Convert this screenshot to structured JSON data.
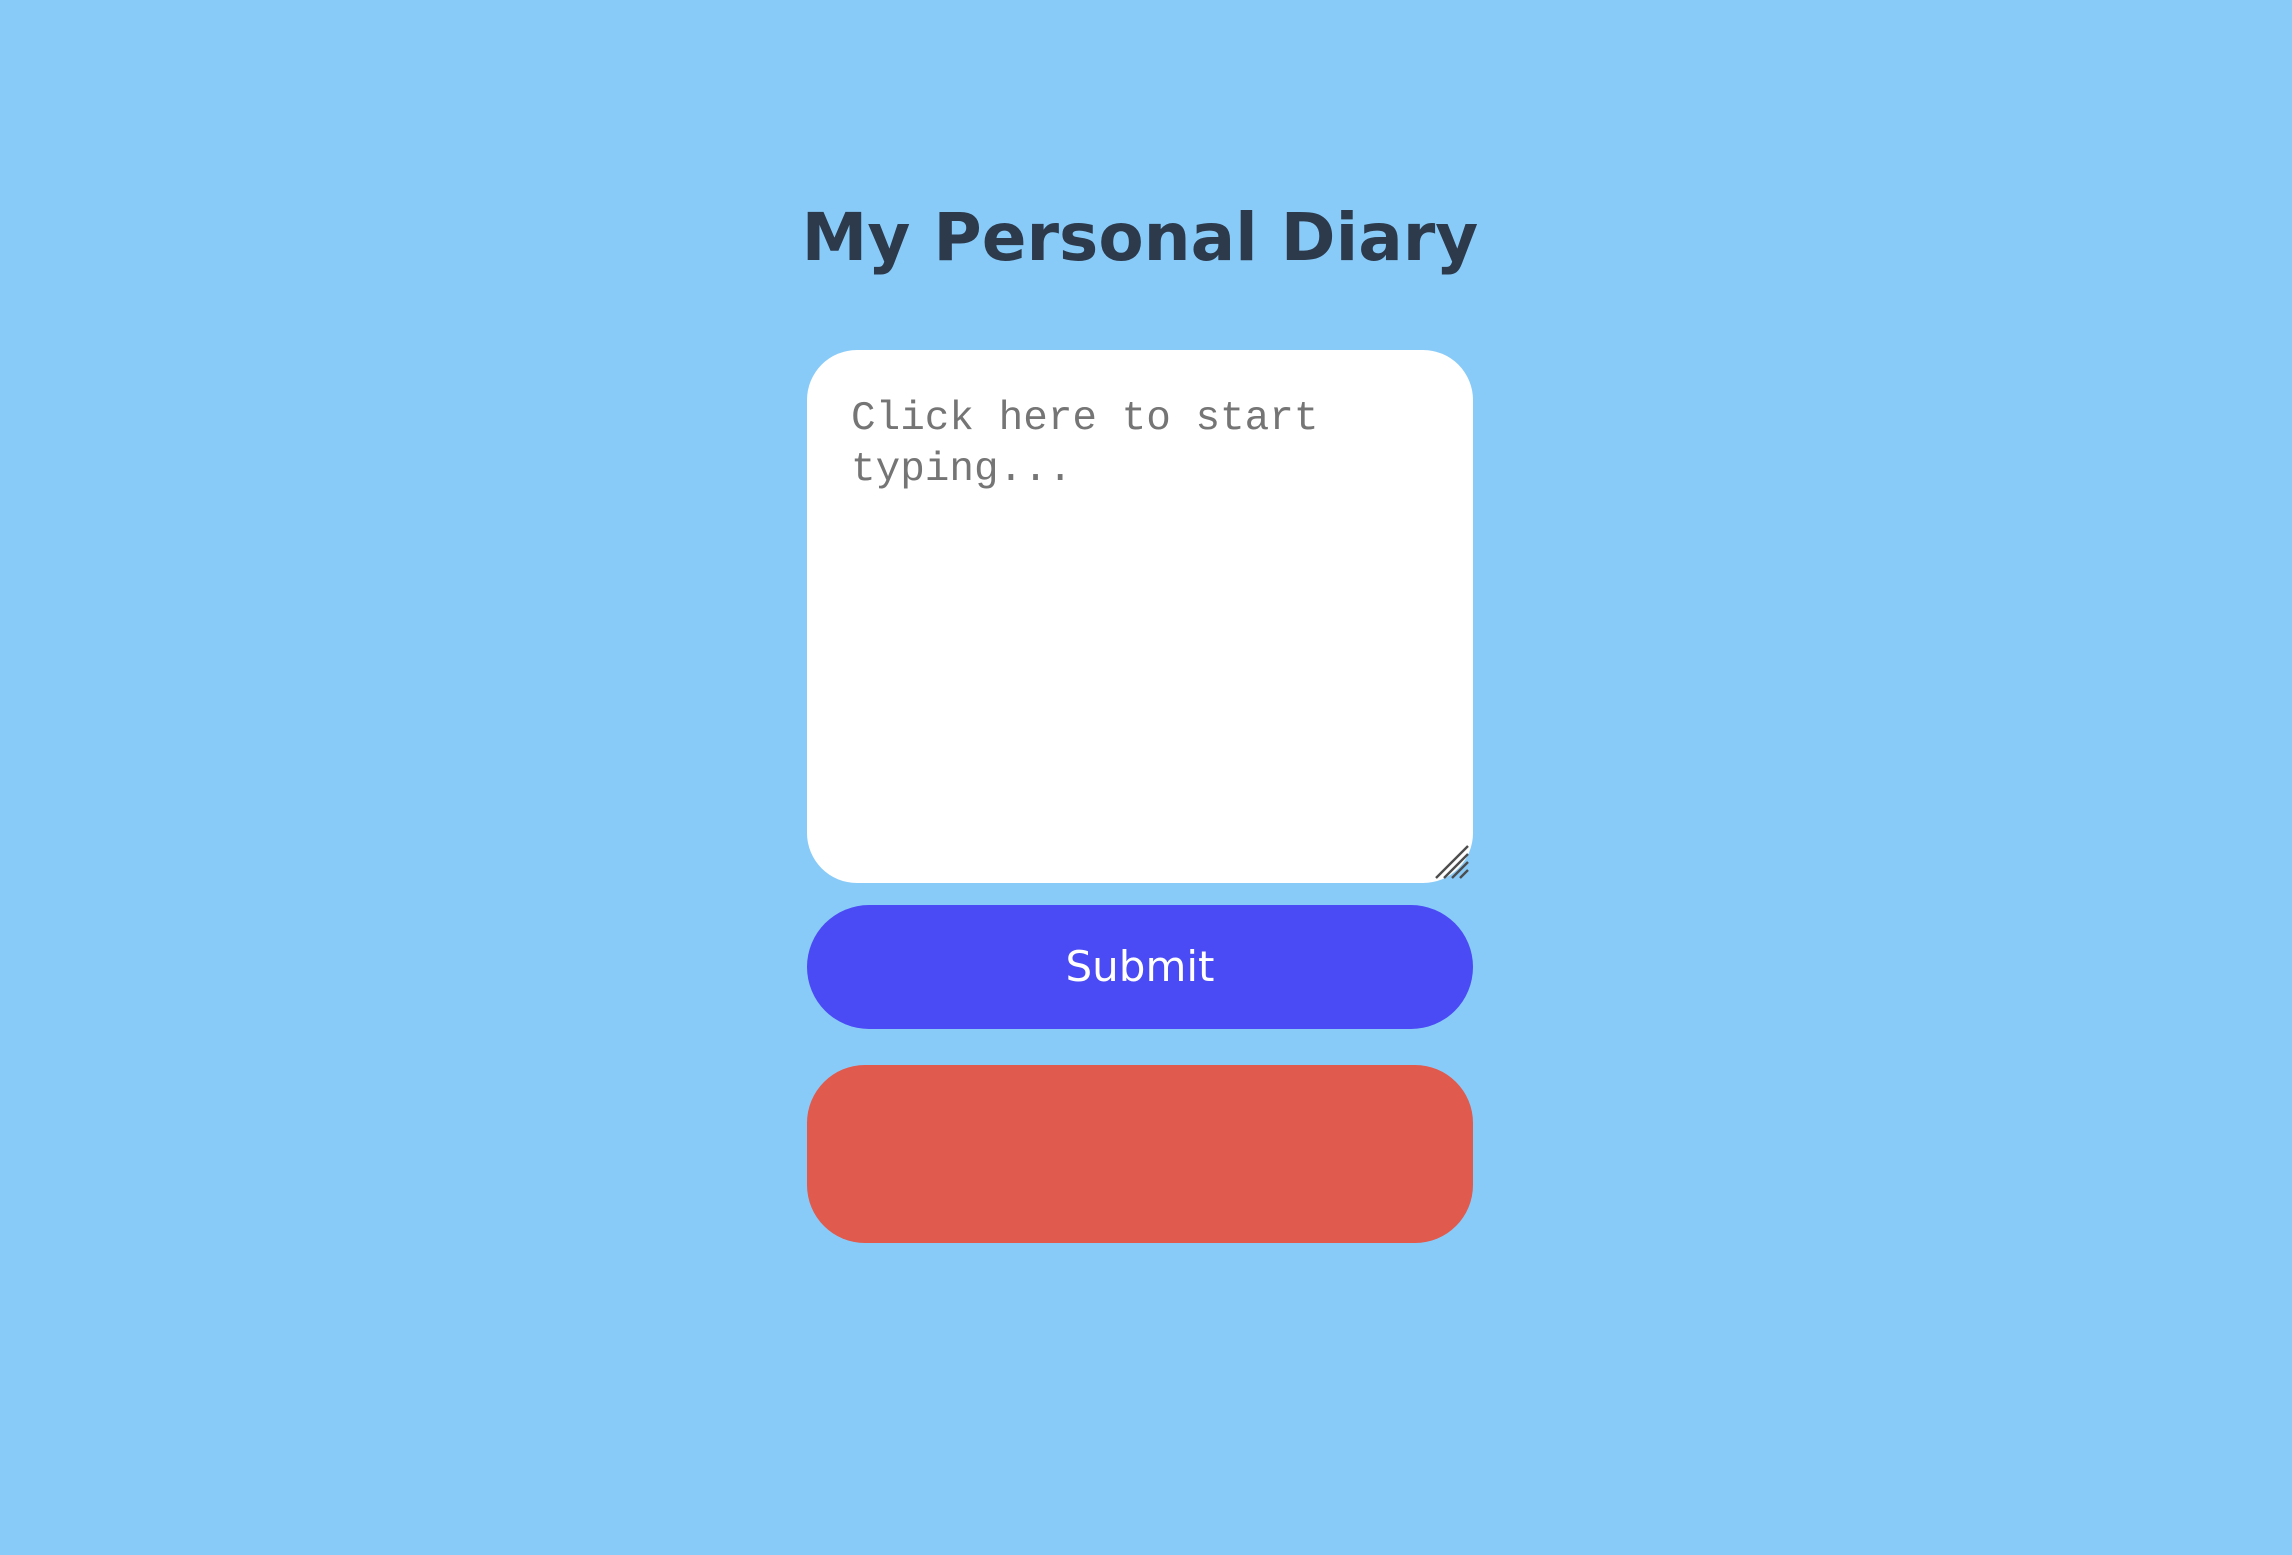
{
  "page": {
    "title": "My Personal Diary"
  },
  "entry": {
    "placeholder": "Click here to start typing...",
    "value": ""
  },
  "actions": {
    "submit_label": "Submit",
    "secondary_label": ""
  },
  "icons": {
    "resize": "resize-grip-icon"
  },
  "colors": {
    "background": "#89cbf8",
    "title": "#2d3a4c",
    "submit": "#4a4bf5",
    "secondary": "#e05a4d",
    "textarea": "#ffffff"
  }
}
